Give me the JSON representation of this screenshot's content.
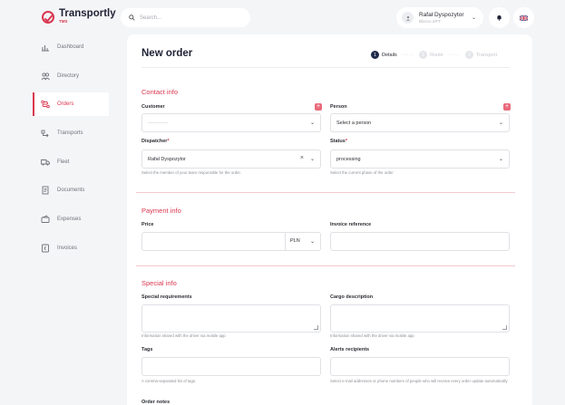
{
  "brand": {
    "name": "Transportly",
    "sub": "TMS"
  },
  "search": {
    "placeholder": "Search..."
  },
  "user": {
    "name": "Rafał Dyspozytor",
    "role": "Blocco 2/FT"
  },
  "icons": {
    "search": "search-icon",
    "bell": "bell-icon",
    "flag": "uk-flag-icon",
    "chevron": "chevron-down-icon"
  },
  "sidebar": {
    "items": [
      {
        "label": "Dashboard",
        "icon": "chart-icon"
      },
      {
        "label": "Directory",
        "icon": "people-icon"
      },
      {
        "label": "Orders",
        "icon": "route-icon",
        "active": true
      },
      {
        "label": "Transports",
        "icon": "transport-icon"
      },
      {
        "label": "Fleet",
        "icon": "truck-icon"
      },
      {
        "label": "Documents",
        "icon": "document-icon"
      },
      {
        "label": "Expenses",
        "icon": "wallet-icon"
      },
      {
        "label": "Invoices",
        "icon": "invoice-icon"
      }
    ]
  },
  "page": {
    "title": "New order",
    "steps": [
      {
        "num": "1",
        "label": "Details",
        "active": true
      },
      {
        "num": "2",
        "label": "Route"
      },
      {
        "num": "3",
        "label": "Transport"
      }
    ]
  },
  "contact": {
    "title": "Contact info",
    "customer_label": "Customer",
    "customer_value": "------------",
    "person_label": "Person",
    "person_value": "Select a person",
    "dispatcher_label": "Dispatcher",
    "dispatcher_value": "Rafał Dyspozytor",
    "dispatcher_hint": "Select the member of your team responsible for the order.",
    "status_label": "Status",
    "status_value": "processing",
    "status_hint": "Select the current phase of the order",
    "required_mark": "*",
    "add_symbol": "+",
    "clear_symbol": "×",
    "chevron": "⌄"
  },
  "payment": {
    "title": "Payment info",
    "price_label": "Price",
    "price_value": "",
    "currency": "PLN",
    "invoice_label": "Invoice reference",
    "invoice_value": ""
  },
  "special": {
    "title": "Special info",
    "requirements_label": "Special requirements",
    "requirements_hint": "Information shared with the driver via mobile app",
    "cargo_label": "Cargo description",
    "cargo_hint": "Information shared with the driver via mobile app",
    "tags_label": "Tags",
    "tags_hint": "A comma-separated list of tags.",
    "alerts_label": "Alerts recipients",
    "alerts_hint": "Select e-mail addresses or phone numbers of people who will receive every order update automatically",
    "notes_label": "Order notes"
  },
  "colors": {
    "accent": "#d9374f",
    "navy": "#1f2235",
    "background": "#f4f5f7"
  }
}
